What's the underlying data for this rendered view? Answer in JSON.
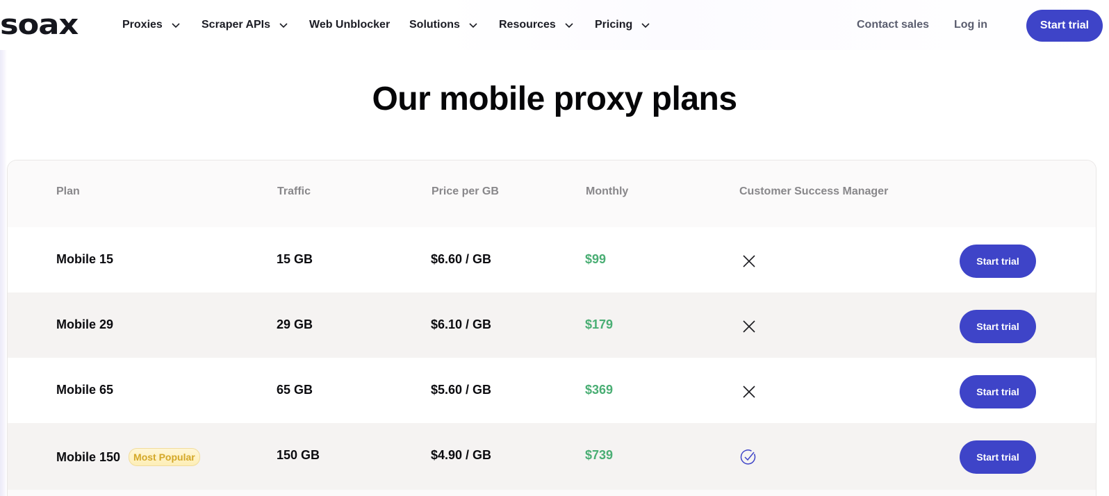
{
  "nav": {
    "logo": "soax",
    "items": [
      {
        "label": "Proxies",
        "dropdown": true
      },
      {
        "label": "Scraper APIs",
        "dropdown": true
      },
      {
        "label": "Web Unblocker",
        "dropdown": false
      },
      {
        "label": "Solutions",
        "dropdown": true
      },
      {
        "label": "Resources",
        "dropdown": true
      },
      {
        "label": "Pricing",
        "dropdown": true
      }
    ],
    "contact_sales": "Contact sales",
    "log_in": "Log in",
    "cta": "Start trial"
  },
  "page": {
    "title": "Our mobile proxy plans"
  },
  "table": {
    "headers": [
      "Plan",
      "Traffic",
      "Price per GB",
      "Monthly",
      "Customer Success Manager"
    ],
    "rows": [
      {
        "plan": "Mobile 15",
        "badge": null,
        "traffic": "15 GB",
        "price_per_gb": "$6.60 / GB",
        "monthly": "$99",
        "csm": "close-icon",
        "button": "Start trial"
      },
      {
        "plan": "Mobile 29",
        "badge": null,
        "traffic": "29 GB",
        "price_per_gb": "$6.10 / GB",
        "monthly": "$179",
        "csm": "close-icon",
        "button": "Start trial"
      },
      {
        "plan": "Mobile 65",
        "badge": null,
        "traffic": "65 GB",
        "price_per_gb": "$5.60 / GB",
        "monthly": "$369",
        "csm": "close-icon",
        "button": "Start trial"
      },
      {
        "plan": "Mobile 150",
        "badge": "Most Popular",
        "traffic": "150 GB",
        "price_per_gb": "$4.90 / GB",
        "monthly": "$739",
        "csm": "check-circle-icon",
        "button": "Start trial"
      }
    ]
  },
  "colors": {
    "brand": "#3e44c8",
    "monthly_price": "#4aae74",
    "badge_text": "#d4a829",
    "header_text": "#88878a"
  }
}
